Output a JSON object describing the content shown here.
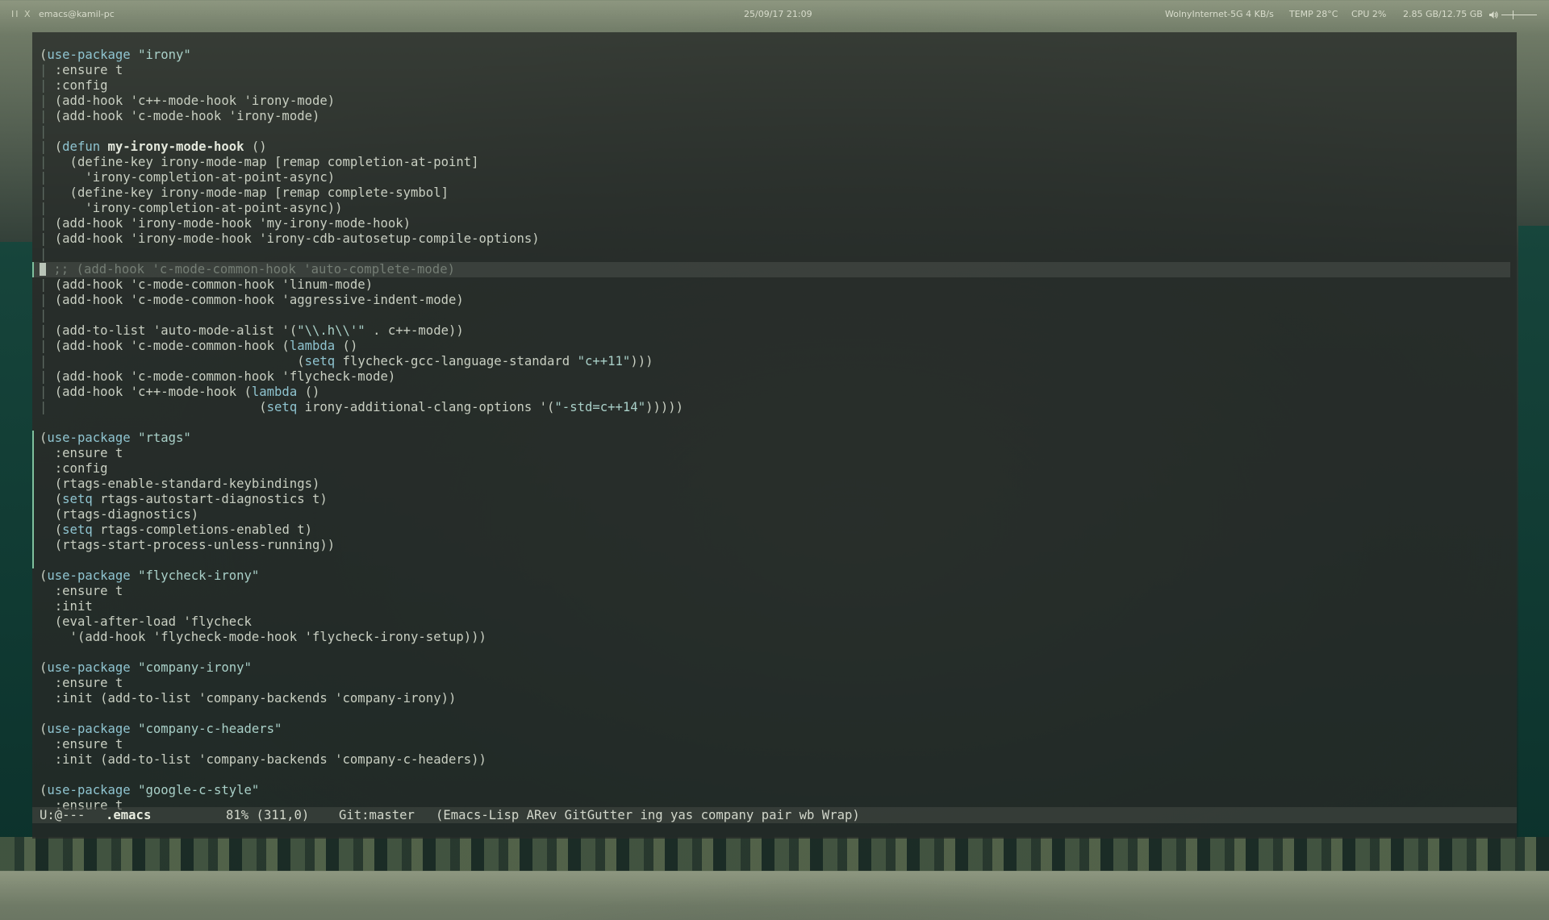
{
  "topbar": {
    "workspace_indicator": "II X",
    "window_title": "emacs@kamil-pc",
    "datetime": "25/09/17 21:09",
    "network": "WolnyInternet-5G  4 KB/s",
    "temp": "TEMP 28°C",
    "cpu": "CPU 2%",
    "memory": "2.85 GB/12.75 GB",
    "volume_icon": "speaker-icon"
  },
  "editor": {
    "lines": [
      "(use-package \"irony\"",
      "  :ensure t",
      "  :config",
      "  (add-hook 'c++-mode-hook 'irony-mode)",
      "  (add-hook 'c-mode-hook 'irony-mode)",
      "",
      "  (defun my-irony-mode-hook ()",
      "    (define-key irony-mode-map [remap completion-at-point]",
      "      'irony-completion-at-point-async)",
      "    (define-key irony-mode-map [remap complete-symbol]",
      "      'irony-completion-at-point-async))",
      "  (add-hook 'irony-mode-hook 'my-irony-mode-hook)",
      "  (add-hook 'irony-mode-hook 'irony-cdb-autosetup-compile-options)",
      "",
      "  ;; (add-hook 'c-mode-common-hook 'auto-complete-mode)",
      "  (add-hook 'c-mode-common-hook 'linum-mode)",
      "  (add-hook 'c-mode-common-hook 'aggressive-indent-mode)",
      "",
      "  (add-to-list 'auto-mode-alist '(\"\\\\.h\\\\'\" . c++-mode))",
      "  (add-hook 'c-mode-common-hook (lambda ()",
      "                                  (setq flycheck-gcc-language-standard \"c++11\")))",
      "  (add-hook 'c-mode-common-hook 'flycheck-mode)",
      "  (add-hook 'c++-mode-hook (lambda ()",
      "                             (setq irony-additional-clang-options '(\"-std=c++14\")))))",
      "",
      "(use-package \"rtags\"",
      "  :ensure t",
      "  :config",
      "  (rtags-enable-standard-keybindings)",
      "  (setq rtags-autostart-diagnostics t)",
      "  (rtags-diagnostics)",
      "  (setq rtags-completions-enabled t)",
      "  (rtags-start-process-unless-running))",
      "",
      "(use-package \"flycheck-irony\"",
      "  :ensure t",
      "  :init",
      "  (eval-after-load 'flycheck",
      "    '(add-hook 'flycheck-mode-hook 'flycheck-irony-setup)))",
      "",
      "(use-package \"company-irony\"",
      "  :ensure t",
      "  :init (add-to-list 'company-backends 'company-irony))",
      "",
      "(use-package \"company-c-headers\"",
      "  :ensure t",
      "  :init (add-to-list 'company-backends 'company-c-headers))",
      "",
      "(use-package \"google-c-style\"",
      "  :ensure t"
    ],
    "current_line_index": 14
  },
  "modeline": {
    "state": "U:@---",
    "buffer": ".emacs",
    "position": "81% (311,0)",
    "vc": "Git:master",
    "modes": "(Emacs-Lisp ARev GitGutter ing yas company pair wb Wrap)"
  }
}
